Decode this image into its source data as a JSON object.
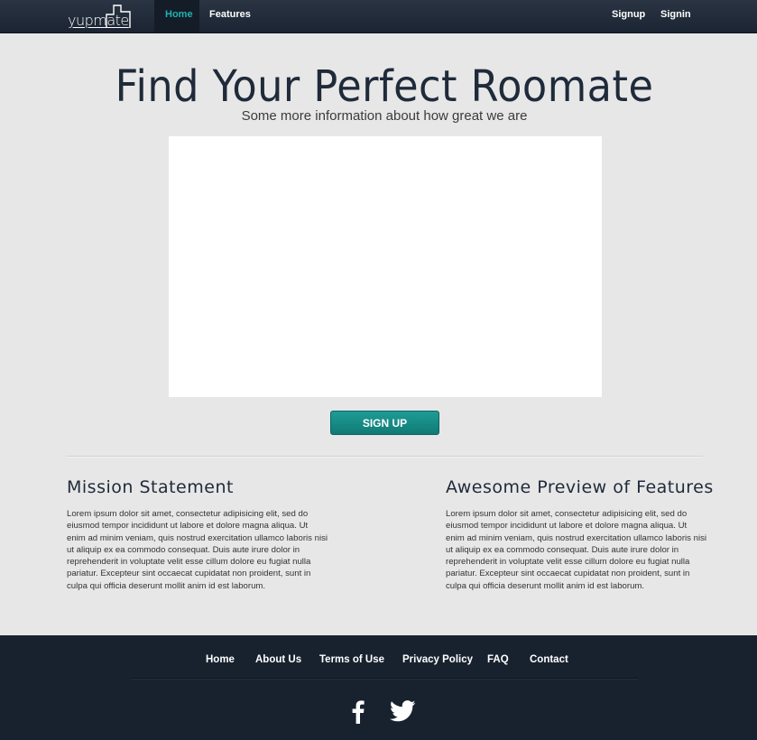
{
  "brand": {
    "logo_text": "yupmate"
  },
  "nav": {
    "home": "Home",
    "features": "Features",
    "signup": "Signup",
    "signin": "Signin"
  },
  "hero": {
    "title": "Find Your Perfect Roomate",
    "subtitle": "Some more information about how great we are",
    "signup_button": "SIGN UP"
  },
  "mission": {
    "title": "Mission Statement",
    "text": "Lorem ipsum dolor sit amet, consectetur adipisicing elit, sed do eiusmod tempor incididunt ut labore et dolore magna aliqua. Ut enim ad minim veniam, quis nostrud exercitation ullamco laboris nisi ut aliquip ex ea commodo consequat. Duis aute irure dolor in reprehenderit in voluptate velit esse cillum dolore eu fugiat nulla pariatur. Excepteur sint occaecat cupidatat non proident, sunt in culpa qui officia deserunt mollit anim id est laborum."
  },
  "features_preview": {
    "title": "Awesome Preview of Features",
    "text": "Lorem ipsum dolor sit amet, consectetur adipisicing elit, sed do eiusmod tempor incididunt ut labore et dolore magna aliqua. Ut enim ad minim veniam, quis nostrud exercitation ullamco laboris nisi ut aliquip ex ea commodo consequat. Duis aute irure dolor in reprehenderit in voluptate velit esse cillum dolore eu fugiat nulla pariatur. Excepteur sint occaecat cupidatat non proident, sunt in culpa qui officia deserunt mollit anim id est laborum."
  },
  "footer": {
    "links": [
      "Home",
      "About Us",
      "Terms of Use",
      "Privacy Policy",
      "FAQ",
      "Contact"
    ],
    "social": [
      "facebook-icon",
      "twitter-icon"
    ]
  },
  "colors": {
    "accent": "#1fb3ac",
    "button": "#1a8f89",
    "navbar": "#1b2433",
    "footer": "#18222f",
    "background": "#e7e7e7",
    "heading": "#1f2a3a"
  }
}
